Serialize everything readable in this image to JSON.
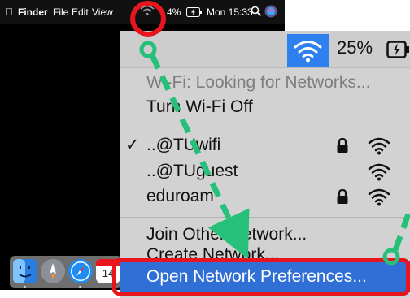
{
  "menubar": {
    "apple_logo": "apple-icon",
    "app_name": "Finder",
    "menus": [
      "File",
      "Edit",
      "View"
    ],
    "battery_text": "4%",
    "clock": "Mon 15:33"
  },
  "dock": {
    "apps": [
      {
        "name": "finder-icon",
        "color": "#2a7de1"
      },
      {
        "name": "launchpad-icon",
        "color": "#8a8f98"
      },
      {
        "name": "safari-icon",
        "color": "#1e8cf0"
      },
      {
        "name": "calendar-icon",
        "color": "#ffffff"
      }
    ],
    "calendar_day": "14"
  },
  "zoom": {
    "battery_text": "25%",
    "menu_items": {
      "status": "Wi-Fi: Looking for Networks...",
      "toggle": "Turn Wi-Fi Off",
      "networks": [
        {
          "name": "..@TUwifi",
          "checked": true,
          "locked": true
        },
        {
          "name": "..@TUguest",
          "checked": false,
          "locked": false
        },
        {
          "name": "eduroam",
          "checked": false,
          "locked": true
        }
      ],
      "join_other": "Join Other Network...",
      "create_network": "Create Network...",
      "open_prefs": "Open Network Preferences..."
    }
  },
  "colors": {
    "highlight_red": "#e8141e",
    "arrow_green": "#26c07a",
    "selection_blue": "#2f6fd6"
  }
}
